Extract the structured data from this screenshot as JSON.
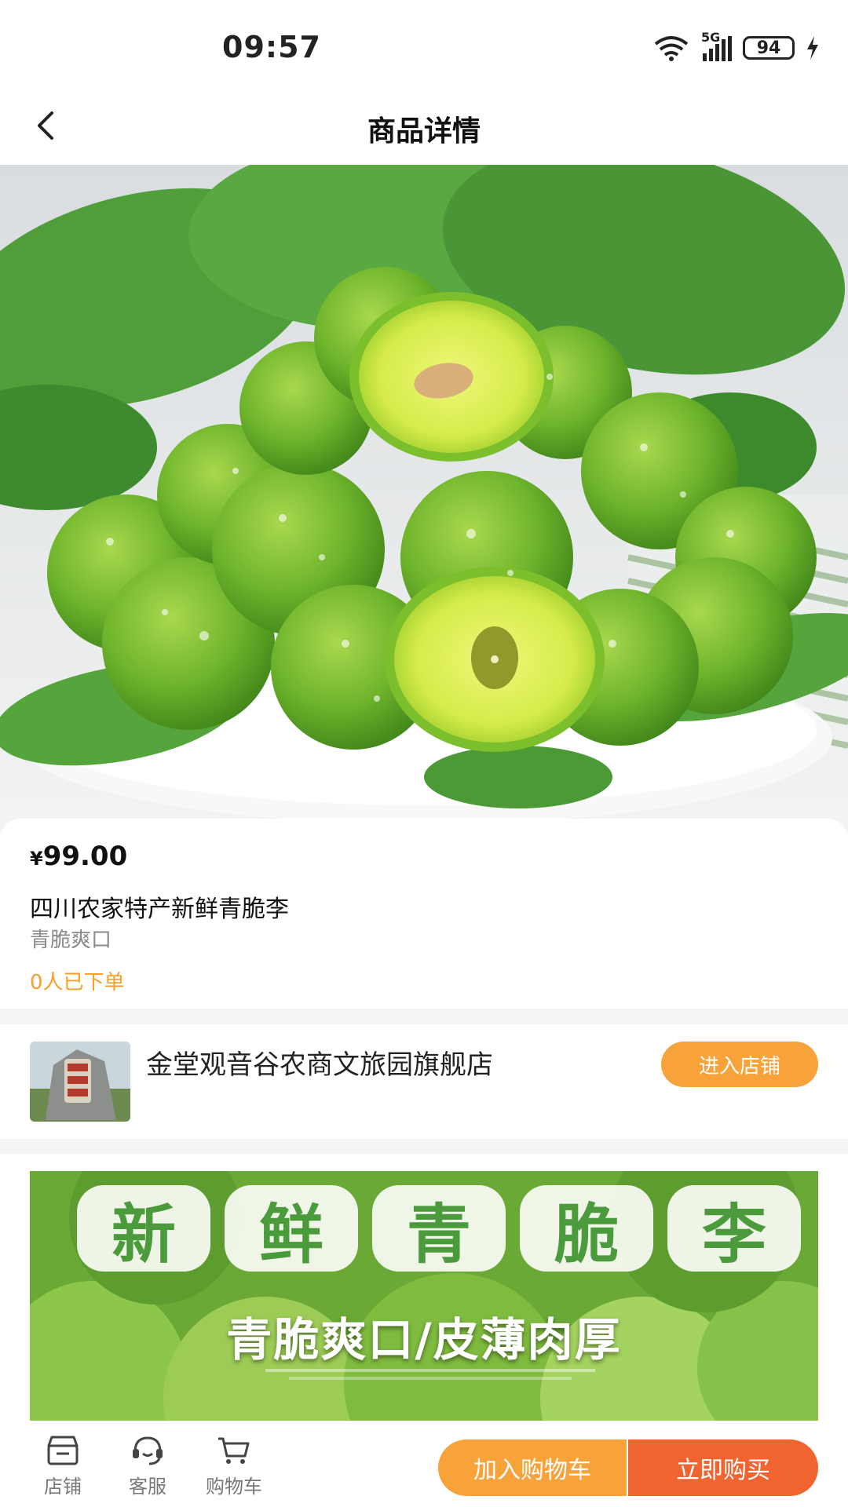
{
  "status_bar": {
    "time": "09:57",
    "network": "5G",
    "battery": "94"
  },
  "nav": {
    "title": "商品详情"
  },
  "product": {
    "price_symbol": "¥",
    "price": "99.00",
    "title": "四川农家特产新鲜青脆李",
    "subtitle": "青脆爽口",
    "orders": "0人已下单"
  },
  "store": {
    "name": "金堂观音谷农商文旅园旗舰店",
    "enter_label": "进入店铺"
  },
  "detail_banner": {
    "chars": [
      "新",
      "鲜",
      "青",
      "脆",
      "李"
    ],
    "subtitle": "青脆爽口/皮薄肉厚"
  },
  "bottom_bar": {
    "tabs": [
      {
        "label": "店铺",
        "icon": "store-icon"
      },
      {
        "label": "客服",
        "icon": "headset-icon"
      },
      {
        "label": "购物车",
        "icon": "cart-icon"
      }
    ],
    "add_to_cart": "加入购物车",
    "buy_now": "立即购买"
  },
  "colors": {
    "orange": "#f7a33a",
    "red_orange": "#f2642f",
    "order_text": "#f7a029"
  }
}
